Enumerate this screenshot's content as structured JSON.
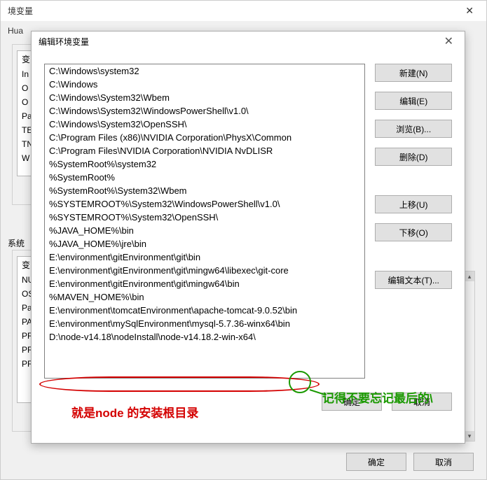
{
  "outer": {
    "title": "境变量",
    "user_vars_legend": "Hua",
    "user_var_header": "变",
    "user_vars": [
      "In",
      "O",
      "O",
      "Pa",
      "TE",
      "TN",
      "W"
    ],
    "sys_vars_label": "系统",
    "sys_var_header": "变",
    "sys_vars": [
      "NU",
      "OS",
      "Pa",
      "PA",
      "PR",
      "PR",
      "PR"
    ],
    "ok": "确定",
    "cancel": "取消"
  },
  "edit": {
    "title": "编辑环境变量",
    "paths": [
      "C:\\Windows\\system32",
      "C:\\Windows",
      "C:\\Windows\\System32\\Wbem",
      "C:\\Windows\\System32\\WindowsPowerShell\\v1.0\\",
      "C:\\Windows\\System32\\OpenSSH\\",
      "C:\\Program Files (x86)\\NVIDIA Corporation\\PhysX\\Common",
      "C:\\Program Files\\NVIDIA Corporation\\NVIDIA NvDLISR",
      "%SystemRoot%\\system32",
      "%SystemRoot%",
      "%SystemRoot%\\System32\\Wbem",
      "%SYSTEMROOT%\\System32\\WindowsPowerShell\\v1.0\\",
      "%SYSTEMROOT%\\System32\\OpenSSH\\",
      "%JAVA_HOME%\\bin",
      "%JAVA_HOME%\\jre\\bin",
      "E:\\environment\\gitEnvironment\\git\\bin",
      "E:\\environment\\gitEnvironment\\git\\mingw64\\libexec\\git-core",
      "E:\\environment\\gitEnvironment\\git\\mingw64\\bin",
      "%MAVEN_HOME%\\bin",
      "E:\\environment\\tomcatEnvironment\\apache-tomcat-9.0.52\\bin",
      "E:\\environment\\mySqlEnvironment\\mysql-5.7.36-winx64\\bin",
      "D:\\node-v14.18\\nodeInstall\\node-v14.18.2-win-x64\\"
    ],
    "btn_new": "新建(N)",
    "btn_edit": "编辑(E)",
    "btn_browse": "浏览(B)...",
    "btn_delete": "删除(D)",
    "btn_up": "上移(U)",
    "btn_down": "下移(O)",
    "btn_edit_text": "编辑文本(T)...",
    "btn_ok": "确定",
    "btn_cancel": "取消"
  },
  "annot": {
    "red_text": "就是node 的安装根目录",
    "green_text": "记得不要忘记最后的\\"
  }
}
